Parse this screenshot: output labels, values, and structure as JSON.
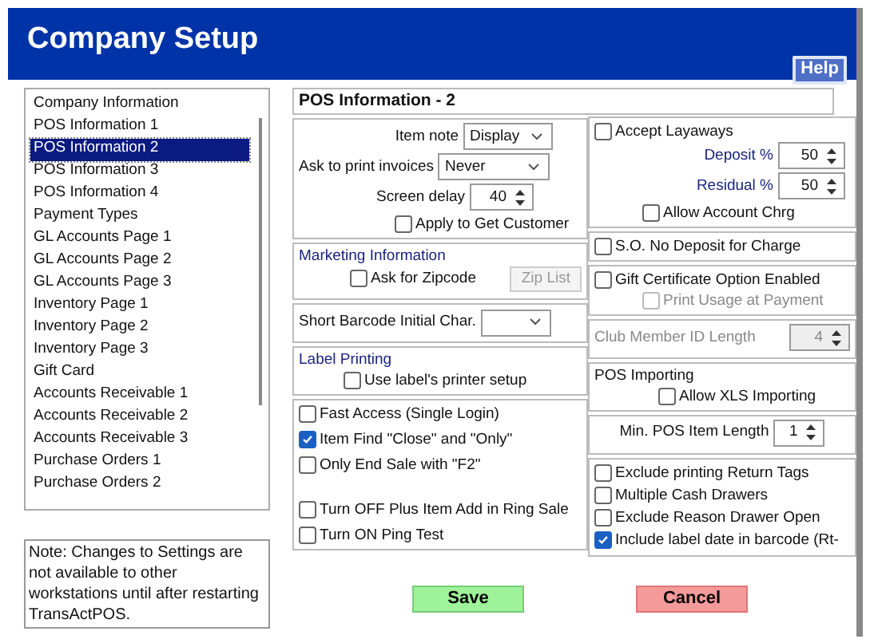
{
  "window": {
    "title": "Company Setup",
    "help_button": "Help"
  },
  "sidebar": {
    "items": [
      {
        "label": "Company Information",
        "selected": false
      },
      {
        "label": "POS Information 1",
        "selected": false
      },
      {
        "label": "POS Information 2",
        "selected": true
      },
      {
        "label": "POS Information 3",
        "selected": false
      },
      {
        "label": "POS Information 4",
        "selected": false
      },
      {
        "label": "Payment Types",
        "selected": false
      },
      {
        "label": "GL Accounts Page 1",
        "selected": false
      },
      {
        "label": "GL Accounts Page 2",
        "selected": false
      },
      {
        "label": "GL Accounts Page 3",
        "selected": false
      },
      {
        "label": "Inventory Page 1",
        "selected": false
      },
      {
        "label": "Inventory Page 2",
        "selected": false
      },
      {
        "label": "Inventory Page 3",
        "selected": false
      },
      {
        "label": "Gift Card",
        "selected": false
      },
      {
        "label": "Accounts Receivable 1",
        "selected": false
      },
      {
        "label": "Accounts Receivable 2",
        "selected": false
      },
      {
        "label": "Accounts Receivable 3",
        "selected": false
      },
      {
        "label": "Purchase Orders 1",
        "selected": false
      },
      {
        "label": "Purchase Orders 2",
        "selected": false
      }
    ]
  },
  "note": "Note: Changes to Settings are not available to other workstations until after restarting TransActPOS.",
  "section_title": "POS Information - 2",
  "item_note": {
    "label": "Item note",
    "value": "Display"
  },
  "ask_print_invoices": {
    "label": "Ask to print invoices",
    "value": "Never"
  },
  "screen_delay": {
    "label": "Screen delay",
    "value": "40"
  },
  "apply_get_customer": {
    "label": "Apply to Get Customer",
    "checked": false
  },
  "marketing": {
    "heading": "Marketing Information",
    "ask_zipcode": {
      "label": "Ask for Zipcode",
      "checked": false
    },
    "zip_list_button": {
      "label": "Zip List",
      "disabled": true
    }
  },
  "short_barcode": {
    "label": "Short Barcode Initial Char."
  },
  "label_printing": {
    "heading": "Label Printing",
    "use_printer_setup": {
      "label": "Use label's printer setup",
      "checked": false
    }
  },
  "options": [
    {
      "label": "Fast Access (Single Login)",
      "checked": false
    },
    {
      "label": "Item Find \"Close\" and \"Only\"",
      "checked": true
    },
    {
      "label": "Only End Sale with \"F2\"",
      "checked": false
    }
  ],
  "options_2": [
    {
      "label": "Turn OFF Plus Item Add in Ring Sale",
      "checked": false
    },
    {
      "label": "Turn ON Ping Test",
      "checked": false
    }
  ],
  "layaways": {
    "accept": {
      "label": "Accept Layaways",
      "checked": false
    },
    "deposit": {
      "label": "Deposit %",
      "value": "50"
    },
    "residual": {
      "label": "Residual %",
      "value": "50"
    },
    "allow_account": {
      "label": "Allow Account Chrg",
      "checked": false
    }
  },
  "so_no_deposit": {
    "label": "S.O. No Deposit for Charge",
    "checked": false
  },
  "gift_certificate": {
    "enabled": {
      "label": "Gift Certificate Option Enabled",
      "checked": false
    },
    "print_usage": {
      "label": "Print Usage at Payment",
      "checked": false,
      "disabled": true
    }
  },
  "club_member_id": {
    "label": "Club Member ID Length",
    "value": "4",
    "disabled": true
  },
  "pos_importing": {
    "heading": "POS Importing",
    "allow_xls": {
      "label": "Allow XLS Importing",
      "checked": false
    }
  },
  "min_pos_item_length": {
    "label": "Min. POS Item Length",
    "value": "1"
  },
  "extra_options": [
    {
      "label": "Exclude printing Return Tags",
      "checked": false
    },
    {
      "label": "Multiple Cash Drawers",
      "checked": false
    },
    {
      "label": "Exclude Reason Drawer Open",
      "checked": false
    },
    {
      "label": "Include label date in barcode (Rt-",
      "checked": true
    }
  ],
  "buttons": {
    "save": "Save",
    "cancel": "Cancel"
  }
}
